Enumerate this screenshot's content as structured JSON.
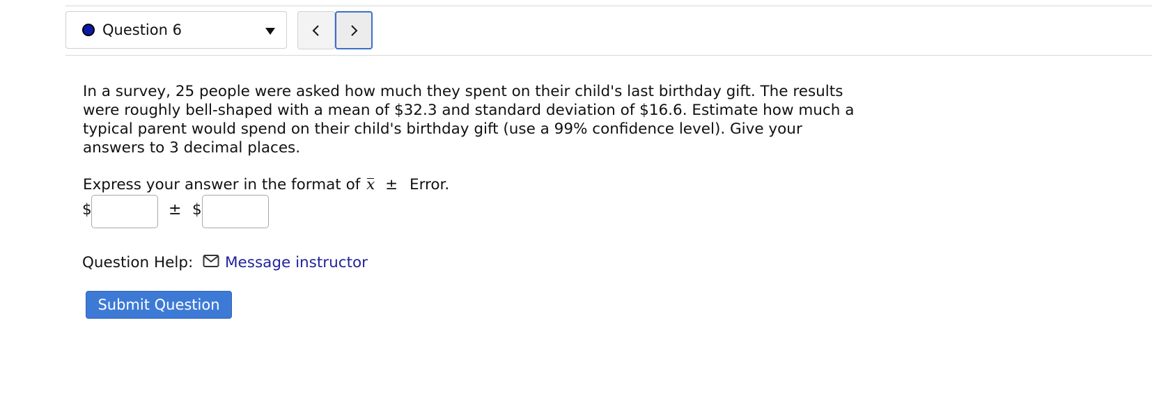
{
  "nav": {
    "question_select": {
      "label": "Question 6",
      "status_color": "#0c1aa8"
    },
    "prev_icon": "chevron-left-icon",
    "next_icon": "chevron-right-icon"
  },
  "question": {
    "text": "In a survey, 25 people were asked how much they spent on their child's last birthday gift. The results were roughly bell-shaped with a mean of $32.3 and standard deviation of $16.6. Estimate how much a typical parent would spend on their child's birthday gift (use a 99% confidence level). Give your answers to 3 decimal places.",
    "format_prefix": "Express your answer in the format of",
    "format_symbol": "x",
    "format_pm": "±",
    "format_suffix": "Error."
  },
  "answer": {
    "currency": "$",
    "pm": "±",
    "mean_value": "",
    "error_value": ""
  },
  "help": {
    "label": "Question Help:",
    "icon": "mail-icon",
    "link_text": "Message instructor",
    "link_color": "#22239c"
  },
  "submit": {
    "label": "Submit Question",
    "color": "#3d7ad6"
  }
}
